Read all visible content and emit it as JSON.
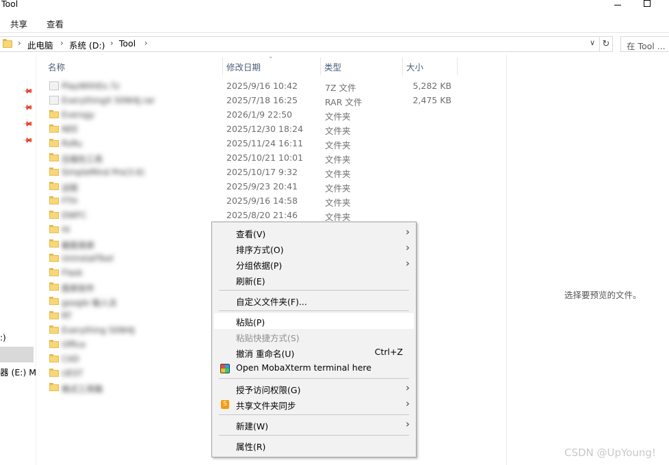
{
  "window": {
    "title": "Tool"
  },
  "ribbon": {
    "tabs": [
      "共享",
      "查看"
    ]
  },
  "address": {
    "breadcrumbs": [
      "此电脑",
      "系统 (D:)",
      "Tool"
    ],
    "dropdown_glyph": "∨",
    "refresh_glyph": "↻",
    "search_placeholder": "在 Tool ..."
  },
  "nav": {
    "drive_1": ":)",
    "drive_2": "器 (E:) M"
  },
  "columns": {
    "name": "名称",
    "modified": "修改日期",
    "type": "类型",
    "size": "大小"
  },
  "files": [
    {
      "icon": "archive",
      "name": "PlayWithEx.7z",
      "date": "2025/9/16 10:42",
      "type": "7Z 文件",
      "size": "5,282 KB"
    },
    {
      "icon": "archive",
      "name": "EverythingX 50W4J.rar",
      "date": "2025/7/18 16:25",
      "type": "RAR 文件",
      "size": "2,475 KB"
    },
    {
      "icon": "folder",
      "name": "Eversgy",
      "date": "2026/1/9 22:50",
      "type": "文件夹",
      "size": ""
    },
    {
      "icon": "folder",
      "name": "NEE",
      "date": "2025/12/30 18:24",
      "type": "文件夹",
      "size": ""
    },
    {
      "icon": "folder",
      "name": "RsRu",
      "date": "2025/11/24 16:11",
      "type": "文件夹",
      "size": ""
    },
    {
      "icon": "folder",
      "name": "压缩包工具",
      "date": "2025/10/21 10:01",
      "type": "文件夹",
      "size": ""
    },
    {
      "icon": "folder",
      "name": "SimpleMind Pro(3.6)",
      "date": "2025/10/17 9:32",
      "type": "文件夹",
      "size": ""
    },
    {
      "icon": "folder",
      "name": "远程",
      "date": "2025/9/23 20:41",
      "type": "文件夹",
      "size": ""
    },
    {
      "icon": "folder",
      "name": "FTH",
      "date": "2025/9/16 14:58",
      "type": "文件夹",
      "size": ""
    },
    {
      "icon": "folder",
      "name": "DWFC",
      "date": "2025/8/20 21:46",
      "type": "文件夹",
      "size": ""
    },
    {
      "icon": "folder",
      "name": "Hi",
      "date": "",
      "type": "",
      "size": ""
    },
    {
      "icon": "folder",
      "name": "截图录屏",
      "date": "",
      "type": "",
      "size": ""
    },
    {
      "icon": "folder",
      "name": "UninstallTool",
      "date": "",
      "type": "",
      "size": ""
    },
    {
      "icon": "folder",
      "name": "Flask",
      "date": "",
      "type": "",
      "size": ""
    },
    {
      "icon": "folder",
      "name": "图表软件",
      "date": "",
      "type": "",
      "size": ""
    },
    {
      "icon": "folder",
      "name": "google 输入法",
      "date": "",
      "type": "",
      "size": ""
    },
    {
      "icon": "folder",
      "name": "RT",
      "date": "",
      "type": "",
      "size": ""
    },
    {
      "icon": "folder",
      "name": "Everything 50W4J",
      "date": "",
      "type": "",
      "size": ""
    },
    {
      "icon": "folder",
      "name": "Office",
      "date": "",
      "type": "",
      "size": ""
    },
    {
      "icon": "folder",
      "name": "CAD",
      "date": "",
      "type": "",
      "size": ""
    },
    {
      "icon": "folder",
      "name": "UEST",
      "date": "",
      "type": "",
      "size": ""
    },
    {
      "icon": "folder",
      "name": "格式工具箱",
      "date": "",
      "type": "",
      "size": ""
    }
  ],
  "preview": {
    "empty_text": "选择要预览的文件。"
  },
  "context_menu": {
    "items": [
      {
        "label": "查看(V)",
        "submenu": true
      },
      {
        "label": "排序方式(O)",
        "submenu": true
      },
      {
        "label": "分组依据(P)",
        "submenu": true
      },
      {
        "label": "刷新(E)"
      },
      {
        "label": "自定义文件夹(F)..."
      },
      {
        "label": "粘贴(P)",
        "highlighted": true
      },
      {
        "label": "粘贴快捷方式(S)",
        "disabled": true
      },
      {
        "label": "撤消 重命名(U)",
        "shortcut": "Ctrl+Z"
      },
      {
        "label": "Open MobaXterm terminal here",
        "icon": "mobaxterm-icon"
      },
      {
        "label": "授予访问权限(G)",
        "submenu": true
      },
      {
        "label": "共享文件夹同步",
        "submenu": true,
        "icon": "sync-icon",
        "icon_glyph": "S"
      },
      {
        "label": "新建(W)",
        "submenu": true
      },
      {
        "label": "属性(R)"
      }
    ],
    "arrow_glyph": "›"
  },
  "watermark": "CSDN @UpYoung!",
  "colors": {
    "folder": "#f8d775",
    "header_text": "#4c607a",
    "menu_bg": "#f2f2f2",
    "selection": "#d9d9d9"
  }
}
